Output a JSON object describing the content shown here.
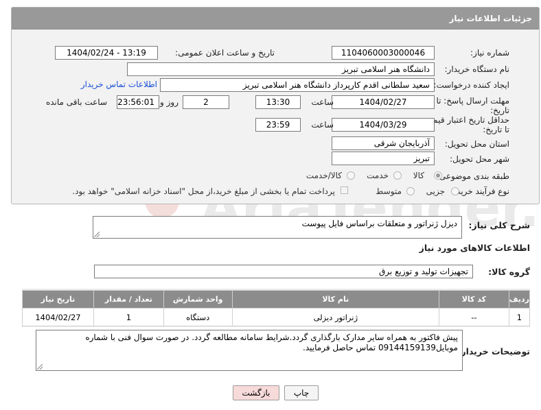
{
  "panel": {
    "title": "جزئیات اطلاعات نیاز"
  },
  "need_number": {
    "label": "شماره نیاز:",
    "value": "1104060003000046"
  },
  "announce_datetime": {
    "label": "تاریخ و ساعت اعلان عمومی:",
    "value": "1404/02/24 - 13:19"
  },
  "buyer_org": {
    "label": "نام دستگاه خریدار:",
    "value": "دانشگاه هنر اسلامی تبریز"
  },
  "requester": {
    "label": "ایجاد کننده درخواست:",
    "value": "سعید سلطانی اقدم کارپرداز دانشگاه هنر اسلامی تبریز",
    "contact_link": "اطلاعات تماس خریدار"
  },
  "reply_deadline": {
    "label": "مهلت ارسال پاسخ: تا تاریخ:",
    "date": "1404/02/27",
    "time_label": "ساعت",
    "time": "13:30",
    "days": "2",
    "days_label": "روز و",
    "remaining": "23:56:01",
    "remaining_label": "ساعت باقی مانده"
  },
  "price_validity": {
    "label": "حداقل تاریخ اعتبار قیمت: تا تاریخ:",
    "date": "1404/03/29",
    "time_label": "ساعت",
    "time": "23:59"
  },
  "delivery_province": {
    "label": "استان محل تحویل:",
    "value": "آذربایجان شرقی"
  },
  "delivery_city": {
    "label": "شهر محل تحویل:",
    "value": "تبریز"
  },
  "category": {
    "label": "طبقه بندی موضوعی:",
    "options": [
      "کالا",
      "خدمت",
      "کالا/خدمت"
    ],
    "selected": "کالا"
  },
  "purchase_type": {
    "label": "نوع فرآیند خرید :",
    "options": [
      "جزیی",
      "متوسط"
    ],
    "payment_note": "پرداخت تمام یا بخشی از مبلغ خرید،از محل \"اسناد خزانه اسلامی\" خواهد بود."
  },
  "description": {
    "label": "شرح کلی نیاز:",
    "value": "دیزل ژنراتور و متعلقات براساس فایل پیوست"
  },
  "goods_section": {
    "title": "اطلاعات کالاهای مورد نیاز"
  },
  "goods_group": {
    "label": "گروه کالا:",
    "value": "تجهیزات تولید و توزیع برق"
  },
  "table": {
    "headers": [
      "ردیف",
      "کد کالا",
      "نام کالا",
      "واحد شمارش",
      "تعداد / مقدار",
      "تاریخ نیاز"
    ],
    "rows": [
      [
        "1",
        "--",
        "ژنراتور دیزلی",
        "دستگاه",
        "1",
        "1404/02/27"
      ]
    ]
  },
  "buyer_notes": {
    "label": "توضیحات خریدار:",
    "value": "پیش فاکتور به همراه سایر مدارک بارگذاری گردد.شرایط سامانه مطالعه گردد. در صورت سوال فنی با شماره موبایل09144159139 تماس حاصل فرمایید."
  },
  "buttons": {
    "print": "چاپ",
    "back": "بازگشت"
  },
  "watermark": {
    "text": "AriaTender.net"
  },
  "colors": {
    "header_bg": "#999999",
    "link": "#1a4fd6",
    "back_btn": "#f7dada",
    "watermark": "#c0392b"
  }
}
